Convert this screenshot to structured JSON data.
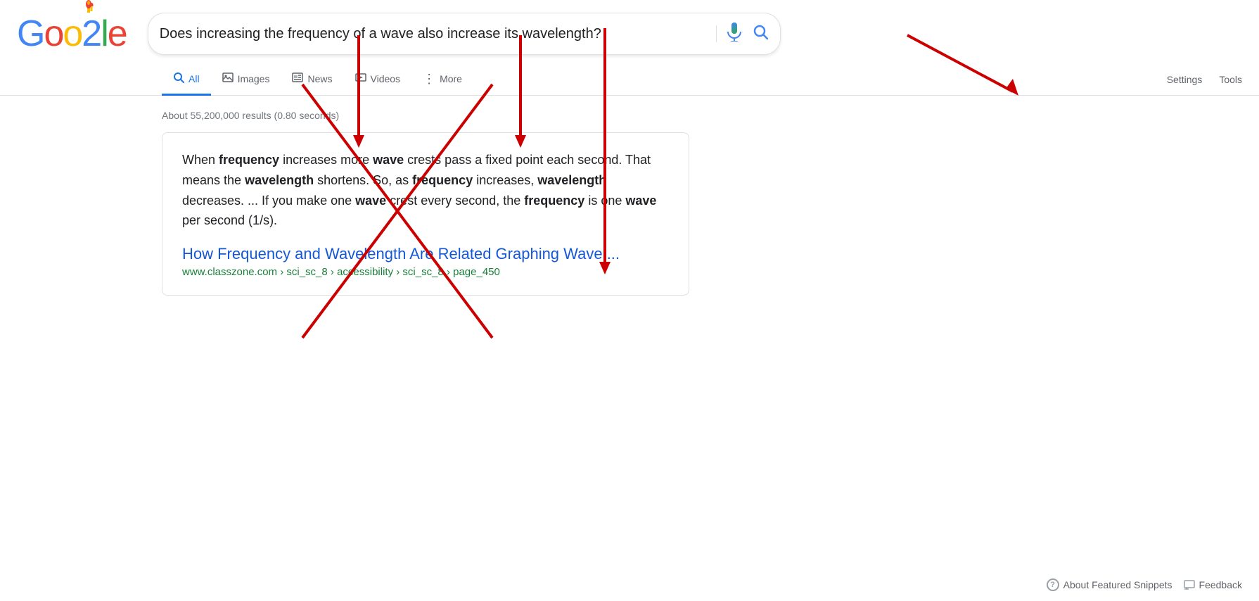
{
  "logo": {
    "letters": [
      "G",
      "o",
      "o",
      "2",
      "l",
      "e"
    ],
    "colors": [
      "#4285F4",
      "#EA4335",
      "#FBBC05",
      "#4285F4",
      "#34A853",
      "#EA4335"
    ]
  },
  "search": {
    "query": "Does increasing the frequency of a wave also increase its wavelength?",
    "mic_label": "Search by voice",
    "search_label": "Google Search"
  },
  "nav": {
    "tabs": [
      {
        "id": "all",
        "label": "All",
        "icon": "🔍",
        "active": true
      },
      {
        "id": "images",
        "label": "Images",
        "icon": "🖼"
      },
      {
        "id": "news",
        "label": "News",
        "icon": "📰"
      },
      {
        "id": "videos",
        "label": "Videos",
        "icon": "▶"
      },
      {
        "id": "more",
        "label": "More",
        "icon": "⋮"
      }
    ],
    "settings": [
      "Settings",
      "Tools"
    ]
  },
  "results": {
    "stats": "About 55,200,000 results (0.80 seconds)"
  },
  "snippet": {
    "text_parts": [
      {
        "text": "When ",
        "bold": false
      },
      {
        "text": "frequency",
        "bold": true
      },
      {
        "text": " increases more ",
        "bold": false
      },
      {
        "text": "wave",
        "bold": true
      },
      {
        "text": " crests pass a fixed point each second. That means the ",
        "bold": false
      },
      {
        "text": "wavelength",
        "bold": true
      },
      {
        "text": " shortens. So, as ",
        "bold": false
      },
      {
        "text": "frequency",
        "bold": true
      },
      {
        "text": " increases, ",
        "bold": false
      },
      {
        "text": "wavelength",
        "bold": true
      },
      {
        "text": " decreases. ... If you make one ",
        "bold": false
      },
      {
        "text": "wave",
        "bold": true
      },
      {
        "text": " crest every second, the ",
        "bold": false
      },
      {
        "text": "frequency",
        "bold": true
      },
      {
        "text": " is one ",
        "bold": false
      },
      {
        "text": "wave",
        "bold": true
      },
      {
        "text": " per second (1/s).",
        "bold": false
      }
    ],
    "link_title": "How Frequency and Wavelength Are Related Graphing Wave ...",
    "url": "www.classzone.com › sci_sc_8 › accessibility › sci_sc_8 › page_450"
  },
  "footer": {
    "about_snippets": "About Featured Snippets",
    "feedback": "Feedback"
  }
}
